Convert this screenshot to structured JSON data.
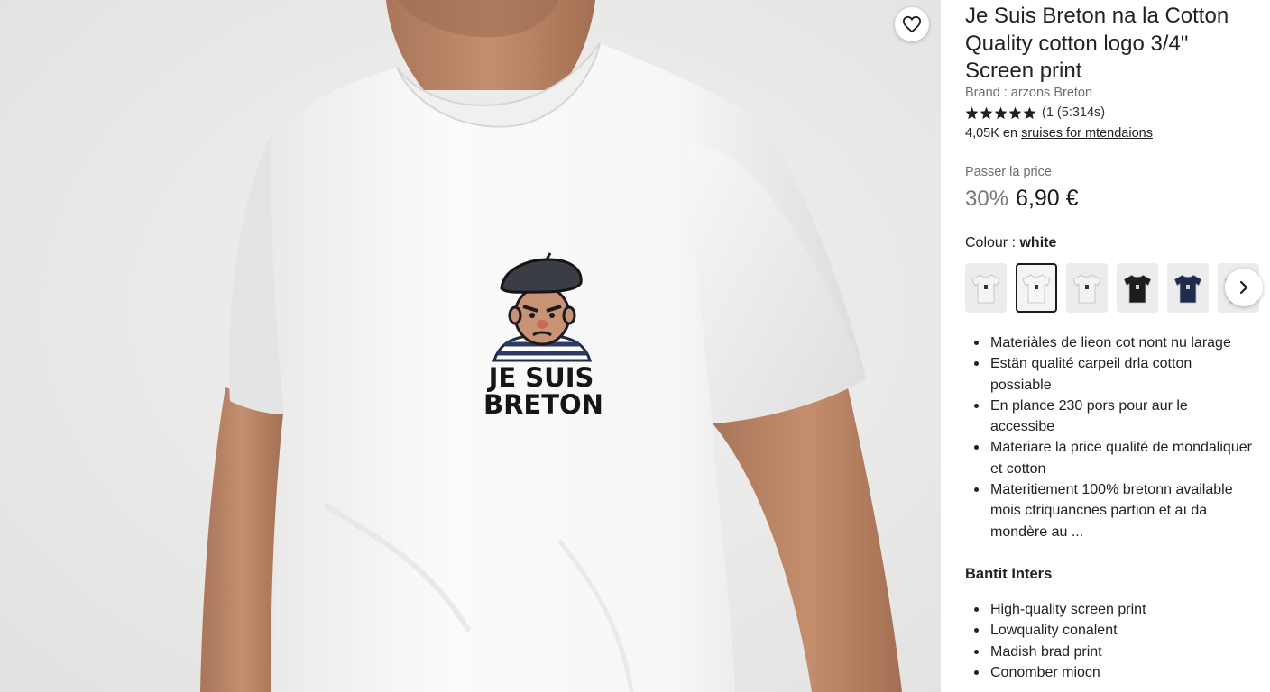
{
  "product": {
    "title": "Je Suis Breton na la Cotton Quality cotton logo 3/4\" Screen print",
    "brand": "Brand : arzons Breton",
    "rating": {
      "stars": 5,
      "text": "(1 (5:314s)"
    },
    "sales_prefix": "4,05K en",
    "sales_link": "sruises for mtendaions",
    "print_text": [
      "JE SUIS",
      "BRETON"
    ]
  },
  "price": {
    "label": "Passer la price",
    "discount": "30%",
    "value": "6,90 €"
  },
  "colour": {
    "label": "Colour :",
    "value": "white",
    "selected_index": 1,
    "swatches": [
      {
        "name": "white",
        "color": "#f4f4f4"
      },
      {
        "name": "white-worn",
        "color": "#f7f7f7"
      },
      {
        "name": "white-plain",
        "color": "#f2f2f2"
      },
      {
        "name": "black",
        "color": "#1d1d1d"
      },
      {
        "name": "navy",
        "color": "#1f2b4d"
      },
      {
        "name": "grey",
        "color": "#dcdcdc"
      }
    ]
  },
  "features": [
    "Materiàles de lieon cot nont nu larage",
    "Estän qualité carpeil drla cotton possiable",
    "En plance 230 pors pour aur le accessibe",
    "Materiare la price qualité de mondaliquer et cotton",
    "Materitiement 100% bretonn available mois ctriquancnes partion et aı da mondère au ..."
  ],
  "benefits": {
    "heading": "Bantit Inters",
    "items": [
      "High-quality screen print",
      "Lowquality conalent",
      "Madish brad print",
      "Conomber miocn"
    ]
  },
  "icons": {
    "favorite": "heart-icon",
    "next": "chevron-right-icon",
    "star": "star-icon"
  }
}
